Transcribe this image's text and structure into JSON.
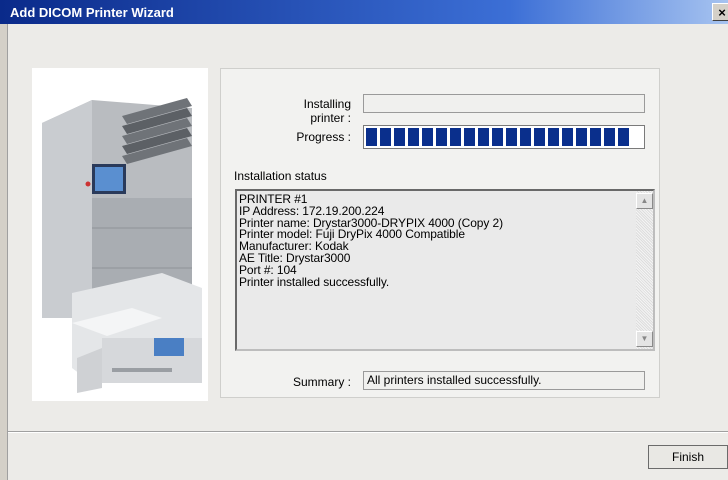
{
  "window": {
    "title": "Add DICOM Printer Wizard",
    "close_glyph": "×"
  },
  "form": {
    "installing_label": "Installing printer :",
    "installing_value": "",
    "progress_label": "Progress :",
    "progress_fraction": 1.0,
    "status_heading": "Installation status",
    "status_lines": [
      "PRINTER #1",
      "IP Address: 172.19.200.224",
      "Printer name: Drystar3000-DRYPIX 4000 (Copy 2)",
      "Printer model: Fuji DryPix 4000 Compatible",
      "Manufacturer: Kodak",
      "AE Title: Drystar3000",
      "Port #: 104",
      "Printer installed successfully."
    ],
    "summary_label": "Summary :",
    "summary_value": "All printers installed successfully."
  },
  "scrollbar": {
    "up_glyph": "▲",
    "down_glyph": "▼"
  },
  "footer": {
    "finish_label": "Finish"
  },
  "colors": {
    "progress_fill": "#0a2f8c",
    "titlebar_start": "#0a2a8a"
  }
}
